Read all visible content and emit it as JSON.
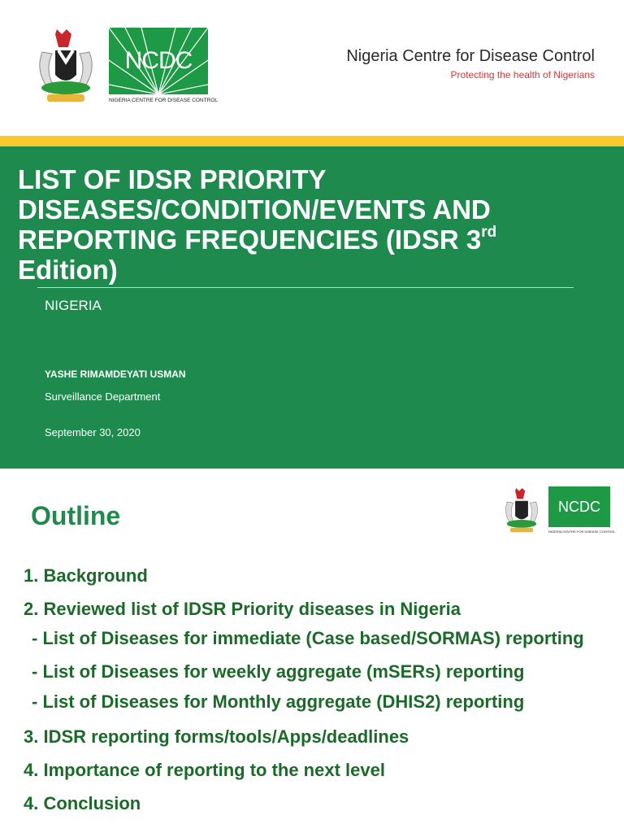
{
  "header": {
    "org_name": "Nigeria Centre for Disease Control",
    "tagline": "Protecting the health of Nigerians",
    "logo_text": "NCDC",
    "logo_subtext": "NIGERIA CENTRE FOR DISEASE CONTROL"
  },
  "cover": {
    "title": "LIST OF IDSR PRIORITY DISEASES/CONDITION/EVENTS AND REPORTING FREQUENCIES (IDSR 3",
    "title_sup": "rd",
    "title_end": " Edition)",
    "country": "NIGERIA",
    "author": "YASHE RIMAMDEYATI USMAN",
    "department": "Surveillance Department",
    "date": "September 30, 2020"
  },
  "outline": {
    "title": "Outline",
    "items": [
      "1. Background",
      "2. Reviewed list of IDSR Priority diseases in Nigeria",
      "- List of Diseases for immediate (Case based/SORMAS) reporting",
      "- List of Diseases for weekly aggregate (mSERs) reporting",
      "- List of Diseases for Monthly aggregate (DHIS2) reporting",
      "3. IDSR reporting forms/tools/Apps/deadlines",
      "4. Importance of reporting to the next level",
      "4. Conclusion"
    ]
  },
  "colors": {
    "green": "#1e8a4e",
    "yellow": "#fdc72f",
    "tagline": "#d0383a"
  }
}
